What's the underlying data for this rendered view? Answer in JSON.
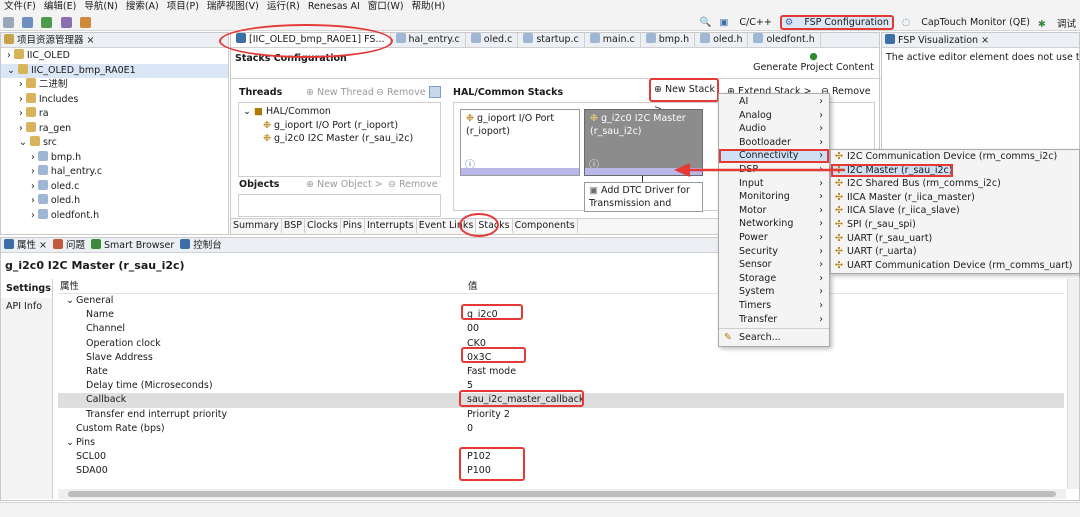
{
  "menubar": [
    "文件(F)",
    "编辑(E)",
    "导航(N)",
    "搜索(A)",
    "项目(P)",
    "瑞萨视图(V)",
    "运行(R)",
    "Renesas AI",
    "窗口(W)",
    "帮助(H)"
  ],
  "perspectives": [
    "C/C++",
    "FSP Configuration",
    "CapTouch Monitor (QE)",
    "调试"
  ],
  "explorer": {
    "title": "项目资源管理器",
    "items": [
      {
        "label": "IIC_OLED",
        "indent": 0,
        "arrow": "›"
      },
      {
        "label": "IIC_OLED_bmp_RA0E1",
        "indent": 0,
        "arrow": "⌄"
      },
      {
        "label": "二进制",
        "indent": 1,
        "arrow": "›"
      },
      {
        "label": "Includes",
        "indent": 1,
        "arrow": "›"
      },
      {
        "label": "ra",
        "indent": 1,
        "arrow": "›"
      },
      {
        "label": "ra_gen",
        "indent": 1,
        "arrow": "›"
      },
      {
        "label": "src",
        "indent": 1,
        "arrow": "⌄"
      },
      {
        "label": "bmp.h",
        "indent": 2,
        "arrow": "›"
      },
      {
        "label": "hal_entry.c",
        "indent": 2,
        "arrow": "›"
      },
      {
        "label": "oled.c",
        "indent": 2,
        "arrow": "›"
      },
      {
        "label": "oled.h",
        "indent": 2,
        "arrow": "›"
      },
      {
        "label": "oledfont.h",
        "indent": 2,
        "arrow": "›"
      }
    ]
  },
  "editor_tabs": [
    "[IIC_OLED_bmp_RA0E1] FS...",
    "hal_entry.c",
    "oled.c",
    "startup.c",
    "main.c",
    "bmp.h",
    "oled.h",
    "oledfont.h"
  ],
  "stacks": {
    "title": "Stacks Configuration",
    "generate": "Generate Project Content",
    "threads_label": "Threads",
    "new_thread": "New Thread",
    "remove": "Remove",
    "objects_label": "Objects",
    "new_object": "New Object >",
    "hal_title": "HAL/Common Stacks",
    "new_stack": "New Stack >",
    "extend_stack": "Extend Stack >",
    "thread_tree": [
      "HAL/Common",
      "g_ioport I/O Port (r_ioport)",
      "g_i2c0 I2C Master (r_sau_i2c)"
    ],
    "card1": "g_ioport I/O Port (r_ioport)",
    "card2": "g_i2c0 I2C Master (r_sau_i2c)",
    "card3": "Add DTC Driver for Transmission and",
    "bottom_tabs": [
      "Summary",
      "BSP",
      "Clocks",
      "Pins",
      "Interrupts",
      "Event Links",
      "Stacks",
      "Components"
    ]
  },
  "viz": {
    "title": "FSP Visualization",
    "msg": "The active editor element does not use thi"
  },
  "menu": {
    "items": [
      "AI",
      "Analog",
      "Audio",
      "Bootloader",
      "Connectivity",
      "DSP",
      "Input",
      "Monitoring",
      "Motor",
      "Networking",
      "Power",
      "Security",
      "Sensor",
      "Storage",
      "System",
      "Timers",
      "Transfer"
    ],
    "search": "Search..."
  },
  "submenu": [
    "I2C Communication Device (rm_comms_i2c)",
    "I2C Master (r_sau_i2c)",
    "I2C Shared Bus (rm_comms_i2c)",
    "IICA Master (r_iica_master)",
    "IICA Slave (r_iica_slave)",
    "SPI (r_sau_spi)",
    "UART (r_sau_uart)",
    "UART (r_uarta)",
    "UART Communication Device (rm_comms_uart)"
  ],
  "props": {
    "tabs": [
      "属性",
      "问题",
      "Smart Browser",
      "控制台"
    ],
    "title": "g_i2c0 I2C Master (r_sau_i2c)",
    "side": [
      "Settings",
      "API Info"
    ],
    "col_prop": "属性",
    "col_val": "值",
    "rows": [
      {
        "k": "General",
        "v": "",
        "indent": 0,
        "group": true
      },
      {
        "k": "Name",
        "v": "g_i2c0",
        "indent": 2
      },
      {
        "k": "Channel",
        "v": "00",
        "indent": 2
      },
      {
        "k": "Operation clock",
        "v": "CK0",
        "indent": 2
      },
      {
        "k": "Slave Address",
        "v": "0x3C",
        "indent": 2
      },
      {
        "k": "Rate",
        "v": "Fast mode",
        "indent": 2
      },
      {
        "k": "Delay time (Microseconds)",
        "v": "5",
        "indent": 2
      },
      {
        "k": "Callback",
        "v": "sau_i2c_master_callback",
        "indent": 2
      },
      {
        "k": "Transfer end interrupt priority",
        "v": "Priority 2",
        "indent": 2
      },
      {
        "k": "Custom Rate (bps)",
        "v": "0",
        "indent": 1
      },
      {
        "k": "Pins",
        "v": "",
        "indent": 0,
        "group": true
      },
      {
        "k": "SCL00",
        "v": "P102",
        "indent": 1
      },
      {
        "k": "SDA00",
        "v": "P100",
        "indent": 1
      }
    ]
  }
}
